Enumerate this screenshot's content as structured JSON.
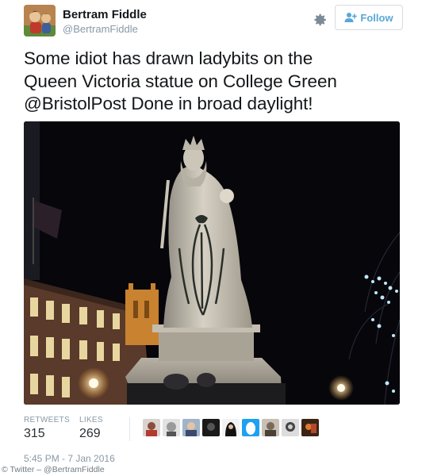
{
  "user": {
    "name": "Bertram Fiddle",
    "handle": "@BertramFiddle"
  },
  "follow_button": {
    "label": "Follow"
  },
  "tweet": {
    "line1": "Some idiot has drawn ladybits on the",
    "line2": "Queen Victoria statue on College Green",
    "mention": "@BristolPost",
    "line3_rest": " Done in broad daylight!"
  },
  "stats": {
    "retweets_label": "RETWEETS",
    "retweets_value": "315",
    "likes_label": "LIKES",
    "likes_value": "269"
  },
  "timestamp": "5:45 PM - 7 Jan 2016",
  "credit": "© Twitter – @BertramFiddle",
  "colors": {
    "link_blue": "#59a7d8",
    "muted_grey": "#8899a6",
    "photo_night": "#07070c"
  }
}
